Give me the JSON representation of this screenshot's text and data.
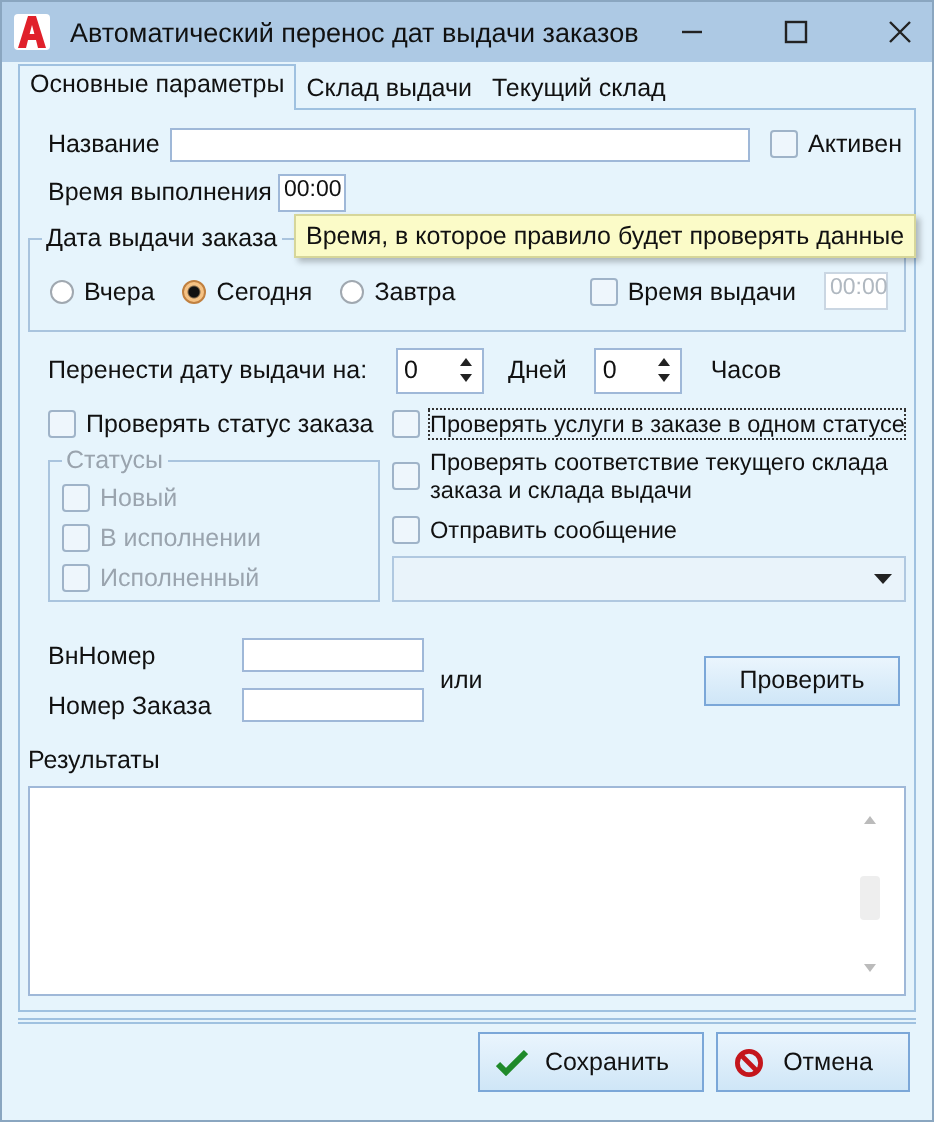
{
  "window": {
    "title": "Автоматический перенос дат выдачи заказов"
  },
  "tabs": [
    {
      "label": "Основные параметры",
      "selected": true
    },
    {
      "label": "Склад выдачи",
      "selected": false
    },
    {
      "label": "Текущий склад",
      "selected": false
    }
  ],
  "name": {
    "label": "Название"
  },
  "active": {
    "label": "Активен",
    "checked": false
  },
  "exec_time": {
    "label": "Время выполнения",
    "value": "00:00"
  },
  "tooltip": {
    "text": "Время, в которое правило будет проверять данные"
  },
  "issue_date": {
    "title": "Дата выдачи заказа",
    "options": [
      {
        "label": "Вчера",
        "selected": false
      },
      {
        "label": "Сегодня",
        "selected": true
      },
      {
        "label": "Завтра",
        "selected": false
      }
    ],
    "issue_time": {
      "label": "Время выдачи",
      "checked": false,
      "value": "00:00",
      "disabled": true
    }
  },
  "shift": {
    "label": "Перенести дату выдачи на:",
    "days": {
      "value": "0",
      "unit": "Дней"
    },
    "hours": {
      "value": "0",
      "unit": "Часов"
    }
  },
  "check_status": {
    "label": "Проверять статус заказа",
    "checked": false
  },
  "statuses": {
    "title": "Статусы",
    "disabled": true,
    "items": [
      {
        "label": "Новый",
        "checked": false
      },
      {
        "label": "В исполнении",
        "checked": false
      },
      {
        "label": "Исполненный",
        "checked": false
      }
    ]
  },
  "right_checks": [
    {
      "label": "Проверять услуги в заказе в одном статусе",
      "checked": false,
      "focused": true
    },
    {
      "label": "Проверять соответствие текущего склада заказа и склада выдачи",
      "checked": false,
      "focused": false
    },
    {
      "label": "Отправить сообщение",
      "checked": false,
      "focused": false
    }
  ],
  "message_dropdown": {
    "disabled": true
  },
  "inner_number": {
    "label": "ВнНомер"
  },
  "order_number": {
    "label": "Номер Заказа"
  },
  "or_text": "или",
  "check_button": {
    "label": "Проверить"
  },
  "results": {
    "label": "Результаты"
  },
  "buttons": [
    {
      "kind": "save",
      "label": "Сохранить"
    },
    {
      "kind": "cancel",
      "label": "Отмена"
    }
  ]
}
